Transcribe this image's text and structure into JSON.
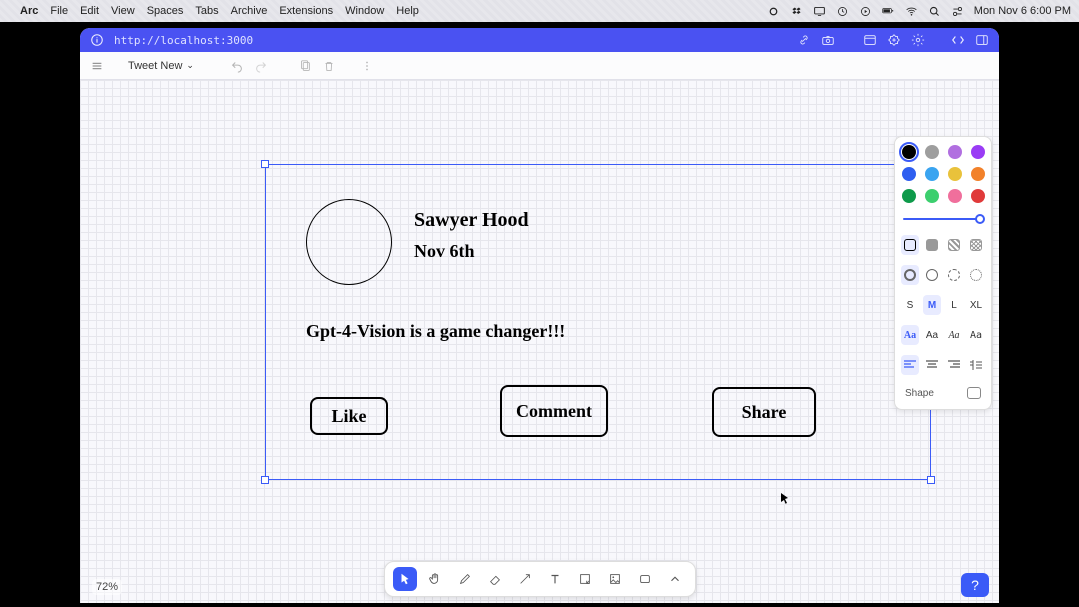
{
  "menubar": {
    "app": "Arc",
    "items": [
      "File",
      "Edit",
      "View",
      "Spaces",
      "Tabs",
      "Archive",
      "Extensions",
      "Window",
      "Help"
    ],
    "datetime": "Mon Nov 6  6:00 PM"
  },
  "browser": {
    "url": "http://localhost:3000"
  },
  "toolbar": {
    "project_name": "Tweet New"
  },
  "card": {
    "name": "Sawyer Hood",
    "date": "Nov 6th",
    "body": "Gpt-4-Vision is a game changer!!!",
    "like_label": "Like",
    "comment_label": "Comment",
    "share_label": "Share"
  },
  "panel": {
    "colors": [
      {
        "hex": "#000000",
        "selected": true
      },
      {
        "hex": "#9e9e9e"
      },
      {
        "hex": "#b16fe0"
      },
      {
        "hex": "#9a3cf5"
      },
      {
        "hex": "#2e5ef0"
      },
      {
        "hex": "#3aa4f0"
      },
      {
        "hex": "#e9c23b"
      },
      {
        "hex": "#f2812a"
      },
      {
        "hex": "#0e9a4a"
      },
      {
        "hex": "#3ccf6e"
      },
      {
        "hex": "#f06f9c"
      },
      {
        "hex": "#e03a3a"
      }
    ],
    "sizes": [
      "S",
      "M",
      "L",
      "XL"
    ],
    "size_selected": "M",
    "shape_label": "Shape"
  },
  "bottom": {
    "zoom": "72%"
  }
}
